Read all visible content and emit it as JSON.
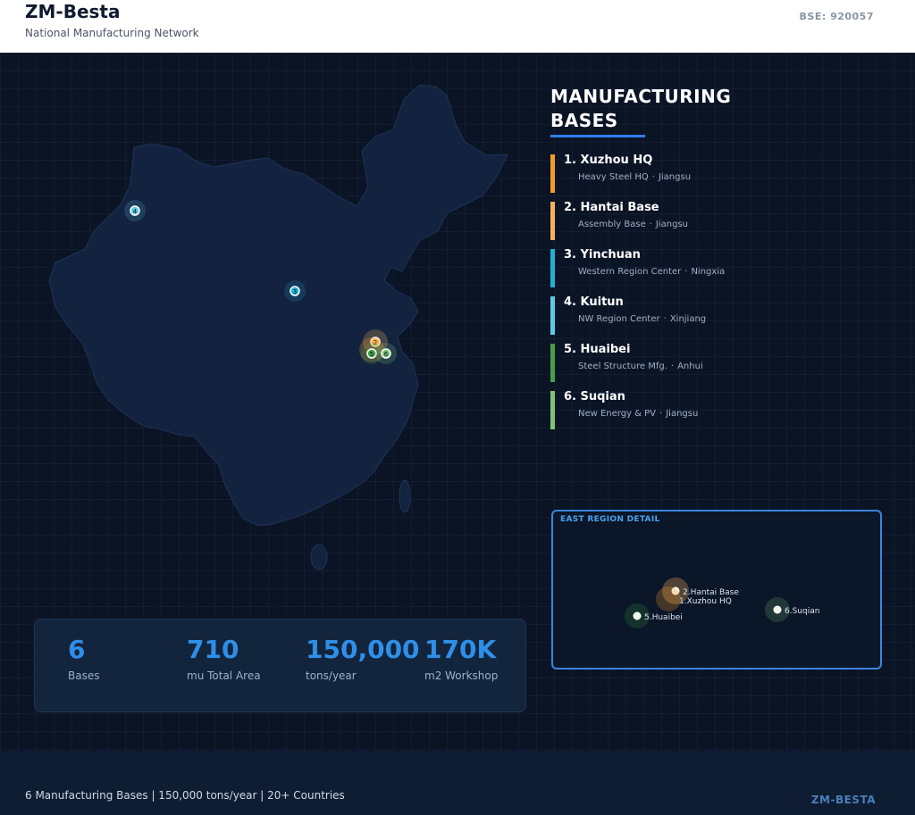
{
  "header": {
    "brand": "ZM-Besta",
    "subtitle": "National Manufacturing Network",
    "code": "BSE: 920057"
  },
  "panel": {
    "title": "MANUFACTURING BASES"
  },
  "bases": [
    {
      "name": "1. Xuzhou HQ",
      "type": "Heavy Steel HQ",
      "province": "Jiangsu",
      "color": "#f39c26"
    },
    {
      "name": "2. Hantai Base",
      "type": "Assembly Base",
      "province": "Jiangsu",
      "color": "#f5b15a"
    },
    {
      "name": "3. Yinchuan",
      "type": "Western Region Center",
      "province": "Ningxia",
      "color": "#1fb1d4"
    },
    {
      "name": "4. Kuitun",
      "type": "NW Region Center",
      "province": "Xinjiang",
      "color": "#5cc9e8"
    },
    {
      "name": "5. Huaibei",
      "type": "Steel Structure Mfg.",
      "province": "Anhui",
      "color": "#43a047"
    },
    {
      "name": "6. Suqian",
      "type": "New Energy & PV",
      "province": "Jiangsu",
      "color": "#7cc576"
    }
  ],
  "map_markers": [
    {
      "number": "1",
      "name": "Xuzhou HQ",
      "color": "#f39c26"
    },
    {
      "number": "2",
      "name": "Hantai Base",
      "color": "#f5b15a"
    },
    {
      "number": "3",
      "name": "Yinchuan",
      "color": "#1fb1d4"
    },
    {
      "number": "4",
      "name": "Kuitun",
      "color": "#5cc9e8"
    },
    {
      "number": "5",
      "name": "Huaibei",
      "color": "#43a047"
    },
    {
      "number": "6",
      "name": "Suqian",
      "color": "#7cc576"
    }
  ],
  "east_detail": {
    "title": "EAST REGION DETAIL",
    "labels": {
      "hantai": "2.Hantai Base",
      "xuzhou": "1.Xuzhou HQ",
      "huaibei": "5.Huaibei",
      "suqian": "6.Suqian"
    }
  },
  "stats": [
    {
      "value": "6",
      "label": "Bases"
    },
    {
      "value": "710",
      "label": "mu Total Area"
    },
    {
      "value": "150,000",
      "label": "tons/year"
    },
    {
      "value": "170K",
      "label": "m2 Workshop"
    }
  ],
  "footer": {
    "text": "6 Manufacturing Bases | 150,000 tons/year | 20+ Countries",
    "brand": "ZM-BESTA"
  }
}
